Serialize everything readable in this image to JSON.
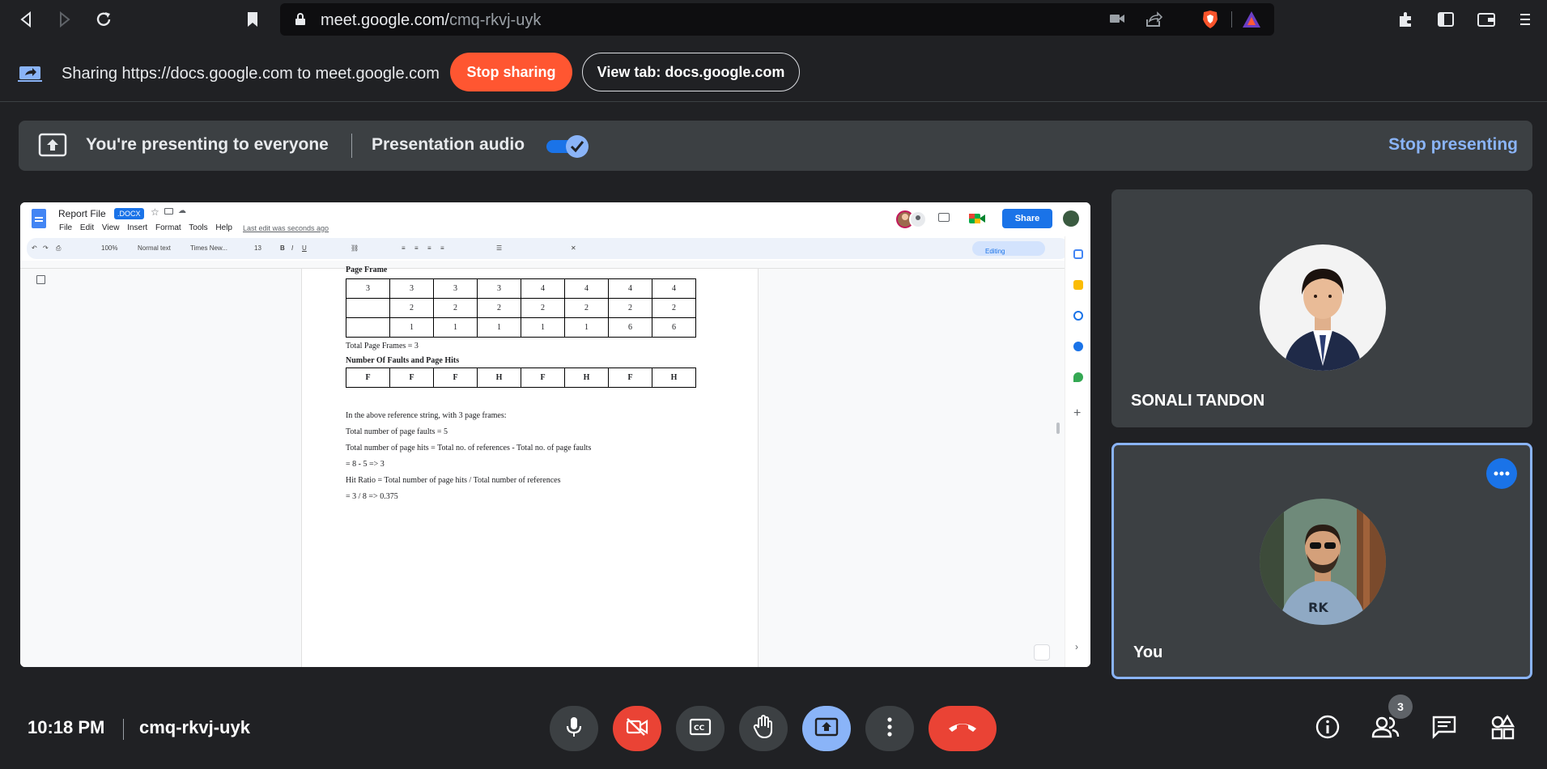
{
  "browser": {
    "url_host": "meet.google.com/",
    "url_path": "cmq-rkvj-uyk"
  },
  "sharing_bar": {
    "text": "Sharing https://docs.google.com to meet.google.com",
    "stop_sharing_label": "Stop sharing",
    "view_tab_label": "View tab: docs.google.com"
  },
  "presenting_banner": {
    "text": "You're presenting to everyone",
    "audio_label": "Presentation audio",
    "audio_enabled": true,
    "stop_presenting_label": "Stop presenting"
  },
  "doc": {
    "title": "Report File",
    "badge": ".DOCX",
    "menus": [
      "File",
      "Edit",
      "View",
      "Insert",
      "Format",
      "Tools",
      "Help"
    ],
    "last_edit": "Last edit was seconds ago",
    "share_label": "Share",
    "toolbar": {
      "zoom": "100%",
      "style": "Normal text",
      "font": "Times New...",
      "size": "13",
      "mode": "Editing"
    },
    "heading_page_frame": "Page Frame",
    "frame_table": [
      [
        "3",
        "3",
        "3",
        "3",
        "4",
        "4",
        "4",
        "4"
      ],
      [
        "",
        "2",
        "2",
        "2",
        "2",
        "2",
        "2",
        "2"
      ],
      [
        "",
        "1",
        "1",
        "1",
        "1",
        "1",
        "6",
        "6"
      ]
    ],
    "total_frames": "Total Page Frames = 3",
    "faults_heading": "Number Of Faults and Page Hits",
    "faults_row": [
      "F",
      "F",
      "F",
      "H",
      "F",
      "H",
      "F",
      "H"
    ],
    "lines": [
      "In the above reference string, with 3 page frames:",
      "Total number of page faults = 5",
      "Total number of page hits = Total no. of references - Total no. of page faults",
      "= 8 - 5 => 3",
      "Hit Ratio = Total number of page hits / Total number of references",
      "= 3 / 8 => 0.375"
    ]
  },
  "participants": [
    {
      "name": "SONALI TANDON"
    },
    {
      "name": "You"
    }
  ],
  "bottom": {
    "time": "10:18 PM",
    "meeting_code": "cmq-rkvj-uyk",
    "people_count": "3"
  },
  "colors": {
    "stop_sharing": "#ff5631",
    "accent_blue": "#8ab4f8",
    "end_call": "#ea4335",
    "docs_share": "#1a73e8"
  }
}
